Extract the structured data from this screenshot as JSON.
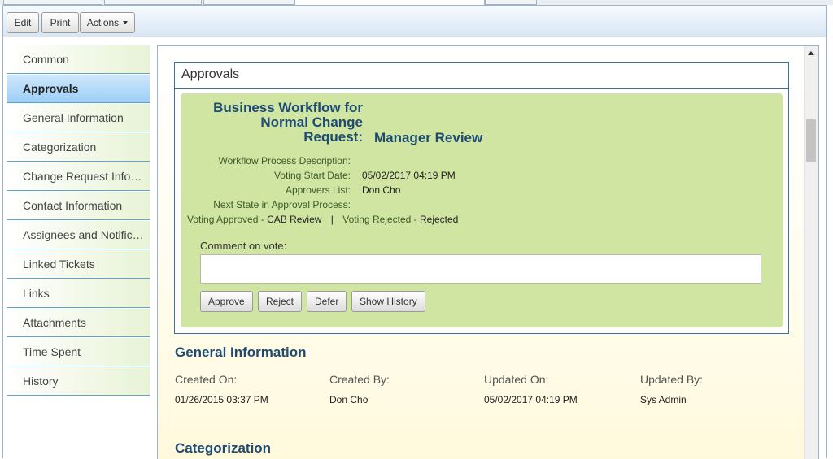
{
  "toolbar": {
    "edit_label": "Edit",
    "print_label": "Print",
    "actions_label": "Actions"
  },
  "sidebar": {
    "items": [
      {
        "label": "Common"
      },
      {
        "label": "Approvals",
        "active": true
      },
      {
        "label": "General Information"
      },
      {
        "label": "Categorization"
      },
      {
        "label": "Change Request Information"
      },
      {
        "label": "Contact Information"
      },
      {
        "label": "Assignees and Notifications"
      },
      {
        "label": "Linked Tickets"
      },
      {
        "label": "Links"
      },
      {
        "label": "Attachments"
      },
      {
        "label": "Time Spent"
      },
      {
        "label": "History"
      }
    ]
  },
  "approvals": {
    "title": "Approvals",
    "workflow_title": "Business Workflow for Normal Change Request:",
    "workflow_title_lines": [
      "Business Workflow for",
      "Normal Change",
      "Request:"
    ],
    "workflow_state": "Manager Review",
    "fields": [
      {
        "label": "Workflow Process Description:",
        "value": ""
      },
      {
        "label": "Voting Start Date:",
        "value": "05/02/2017 04:19 PM"
      },
      {
        "label": "Approvers List:",
        "value": "Don Cho"
      },
      {
        "label": "Next State in Approval Process:",
        "value": ""
      }
    ],
    "outcome_approved_label": "Voting Approved -",
    "outcome_approved_value": "CAB Review",
    "outcome_separator": "|",
    "outcome_rejected_label": "Voting Rejected -",
    "outcome_rejected_value": "Rejected",
    "comment_label": "Comment on vote:",
    "comment_value": "",
    "buttons": {
      "approve": "Approve",
      "reject": "Reject",
      "defer": "Defer",
      "show_history": "Show History"
    }
  },
  "general_information": {
    "heading": "General Information",
    "columns": [
      {
        "label": "Created On:",
        "value": "01/26/2015 03:37 PM"
      },
      {
        "label": "Created By:",
        "value": "Don Cho"
      },
      {
        "label": "Updated On:",
        "value": "05/02/2017 04:19 PM"
      },
      {
        "label": "Updated By:",
        "value": "Sys Admin"
      }
    ]
  },
  "categorization": {
    "heading": "Categorization"
  },
  "colors": {
    "heading_blue": "#1e4b72",
    "panel_green": "#d1e5a3",
    "active_tab_blue": "#9ccff6",
    "border_blue": "#3b6f9b"
  }
}
